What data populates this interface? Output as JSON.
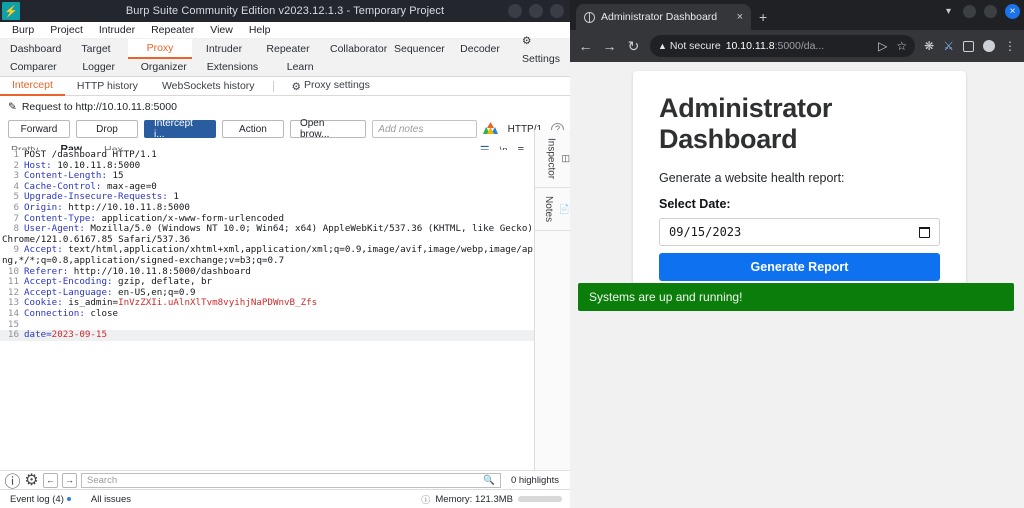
{
  "burp": {
    "title": "Burp Suite Community Edition v2023.12.1.3 - Temporary Project",
    "logo_glyph": "⚡",
    "menu": [
      "Burp",
      "Project",
      "Intruder",
      "Repeater",
      "View",
      "Help"
    ],
    "tabs_row1": [
      "Dashboard",
      "Target",
      "Proxy",
      "Intruder",
      "Repeater",
      "Collaborator",
      "Sequencer",
      "Decoder"
    ],
    "settings_label": "Settings",
    "tabs_row2": [
      "Comparer",
      "Logger",
      "Organizer",
      "Extensions",
      "Learn"
    ],
    "active_tab": "Proxy",
    "subtabs": [
      "Intercept",
      "HTTP history",
      "WebSockets history"
    ],
    "proxy_settings_label": "Proxy settings",
    "active_subtab": "Intercept",
    "request_header": "Request to http://10.10.11.8:5000",
    "buttons": {
      "forward": "Forward",
      "drop": "Drop",
      "intercept": "Intercept i...",
      "action": "Action",
      "open_browser": "Open brow...",
      "notes_placeholder": "Add notes",
      "http_version": "HTTP/1"
    },
    "view_tabs": [
      "Pretty",
      "Raw",
      "Hex"
    ],
    "active_view_tab": "Raw",
    "request_lines": [
      {
        "n": "1",
        "name": "",
        "value": "POST /dashboard HTTP/1.1",
        "plain": true
      },
      {
        "n": "2",
        "name": "Host",
        "value": " 10.10.11.8:5000"
      },
      {
        "n": "3",
        "name": "Content-Length",
        "value": " 15"
      },
      {
        "n": "4",
        "name": "Cache-Control",
        "value": " max-age=0"
      },
      {
        "n": "5",
        "name": "Upgrade-Insecure-Requests",
        "value": " 1"
      },
      {
        "n": "6",
        "name": "Origin",
        "value": " http://10.10.11.8:5000"
      },
      {
        "n": "7",
        "name": "Content-Type",
        "value": " application/x-www-form-urlencoded"
      },
      {
        "n": "8",
        "name": "User-Agent",
        "value": " Mozilla/5.0 (Windows NT 10.0; Win64; x64) AppleWebKit/537.36 (KHTML, like Gecko) Chrome/121.0.6167.85 Safari/537.36"
      },
      {
        "n": "9",
        "name": "Accept",
        "value": " text/html,application/xhtml+xml,application/xml;q=0.9,image/avif,image/webp,image/apng,*/*;q=0.8,application/signed-exchange;v=b3;q=0.7"
      },
      {
        "n": "10",
        "name": "Referer",
        "value": " http://10.10.11.8:5000/dashboard"
      },
      {
        "n": "11",
        "name": "Accept-Encoding",
        "value": " gzip, deflate, br"
      },
      {
        "n": "12",
        "name": "Accept-Language",
        "value": " en-US,en;q=0.9"
      },
      {
        "n": "13",
        "name": "Cookie",
        "value": " is_admin=",
        "cookie": "InVzZXIi.uAlnXlTvm8vyihjNaPDWnvB_Zfs"
      },
      {
        "n": "14",
        "name": "Connection",
        "value": " close"
      },
      {
        "n": "15",
        "name": "",
        "value": "",
        "plain": true
      }
    ],
    "body_line": {
      "n": "16",
      "key": "date",
      "value": "2023-09-15"
    },
    "rail": [
      {
        "label": "Inspector",
        "icon": "inspector-icon"
      },
      {
        "label": "Notes",
        "icon": "notes-icon"
      }
    ],
    "search": {
      "placeholder": "Search",
      "highlights": "0 highlights"
    },
    "status": {
      "event_log": "Event log (4)",
      "all_issues": "All issues",
      "memory": "Memory: 121.3MB"
    }
  },
  "chrome": {
    "tab_title": "Administrator Dashboard",
    "new_tab_glyph": "+",
    "close_glyph": "×",
    "security_label": "Not secure",
    "url_host": "10.10.11.8",
    "url_rest": ":5000/da...",
    "toolbar_icons": [
      "back-icon",
      "forward-icon",
      "reload-icon",
      "share-icon",
      "bookmark-star-icon",
      "extensions-puzzle-icon",
      "lab-flask-icon",
      "side-panel-icon",
      "profile-avatar-icon",
      "chrome-menu-icon"
    ]
  },
  "page": {
    "heading": "Administrator Dashboard",
    "subtitle": "Generate a website health report:",
    "date_label": "Select Date:",
    "date_value": "09/15/2023",
    "generate_button": "Generate Report",
    "status_message": "Systems are up and running!",
    "status_color": "#0b7d0b",
    "button_color": "#0d71f0"
  }
}
